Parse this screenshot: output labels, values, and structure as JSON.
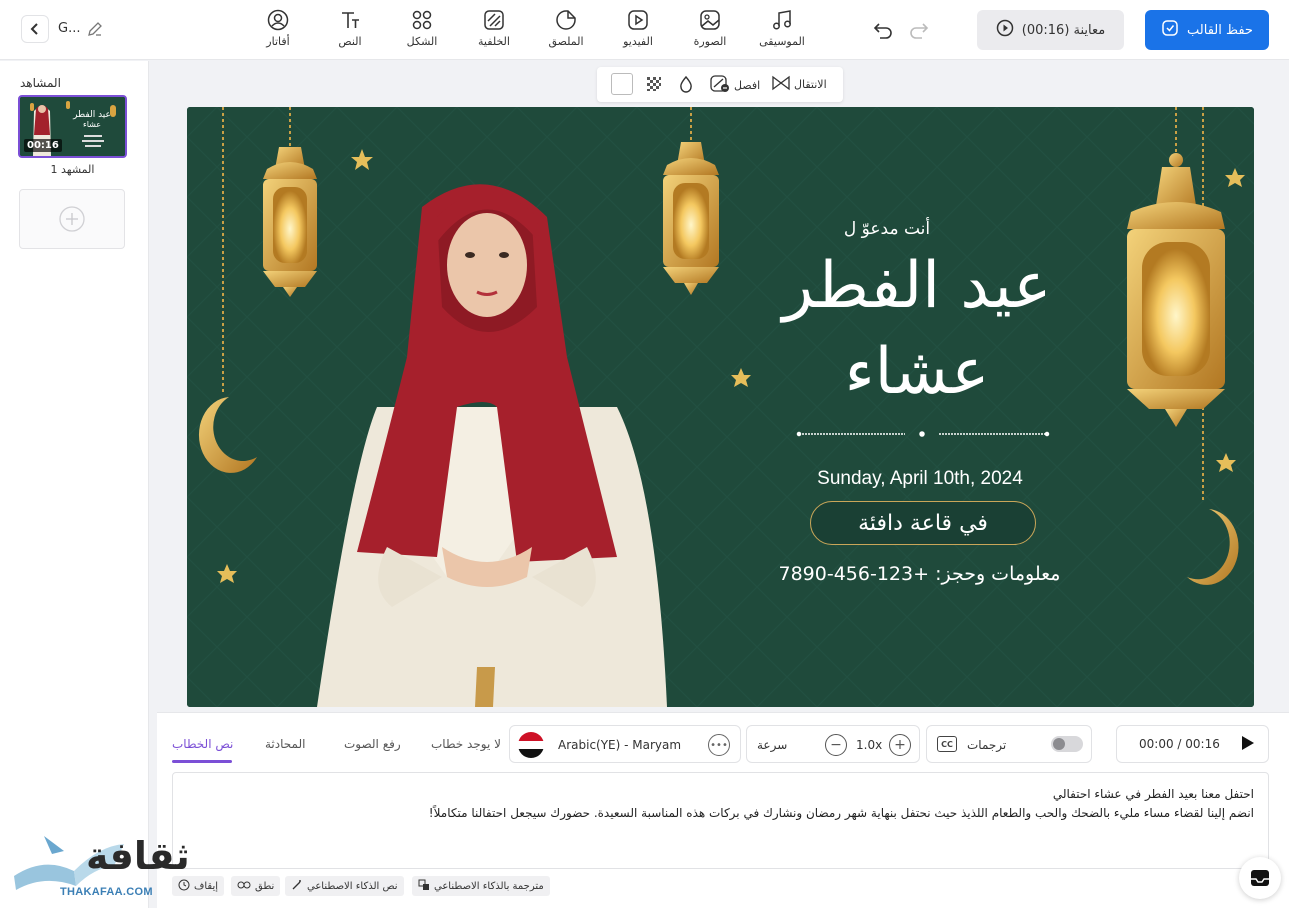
{
  "topbar": {
    "project_name": "G...",
    "tools": [
      {
        "label": "أفاتار",
        "icon": "avatar-icon"
      },
      {
        "label": "النص",
        "icon": "text-icon"
      },
      {
        "label": "الشكل",
        "icon": "shape-icon"
      },
      {
        "label": "الخلفية",
        "icon": "background-icon"
      },
      {
        "label": "الملصق",
        "icon": "sticker-icon"
      },
      {
        "label": "الفيديو",
        "icon": "video-icon"
      },
      {
        "label": "الصورة",
        "icon": "image-icon"
      },
      {
        "label": "الموسيقى",
        "icon": "music-icon"
      }
    ],
    "preview_label": "معاينة (00:16)",
    "save_label": "حفظ القالب"
  },
  "scenes": {
    "title": "المشاهد",
    "items": [
      {
        "label": "المشهد 1",
        "duration": "00:16",
        "thumb_title": "عيد الفطر",
        "thumb_sub": "عشاء"
      }
    ]
  },
  "canvas_toolbar": {
    "transition_label": "الانتقال",
    "split_label": "افصل"
  },
  "canvas": {
    "invite": "أنت مدعوّ ل",
    "title_line1": "عيد الفطر",
    "title_line2": "عشاء",
    "date": "Sunday, April 10th, 2024",
    "venue": "في قاعة دافئة",
    "info": "معلومات وحجز: +123-456-7890"
  },
  "bottom": {
    "time": "00:00 / 00:16",
    "captions_label": "ترجمات",
    "speed_label": "سرعة",
    "speed_value": "1.0x",
    "voice_name": "Arabic(YE) - Maryam",
    "tabs": [
      "نص الخطاب",
      "المحادثة",
      "رفع الصوت",
      "لا يوجد خطاب"
    ],
    "active_tab": 0,
    "script_lines": [
      "احتفل معنا بعيد الفطر في عشاء احتفالي",
      "انضم إلينا لقضاء مساء مليء بالضحك والحب والطعام اللذيذ حيث نحتفل بنهاية شهر رمضان ونشارك في بركات هذه المناسبة السعيدة. حضورك سيجعل احتفالنا متكاملاً!"
    ],
    "chips": [
      "مترجمة بالذكاء الاصطناعي",
      "نص الذكاء الاصطناعي",
      "نطق",
      "إيقاف"
    ]
  },
  "watermark": {
    "arabic": "ثقافة",
    "latin": "THAKAFAA.COM"
  },
  "colors": {
    "accent": "#1a73e8",
    "tab_active": "#7b4fd6",
    "canvas_bg": "#1f4a3b",
    "gold": "#d9a441"
  }
}
